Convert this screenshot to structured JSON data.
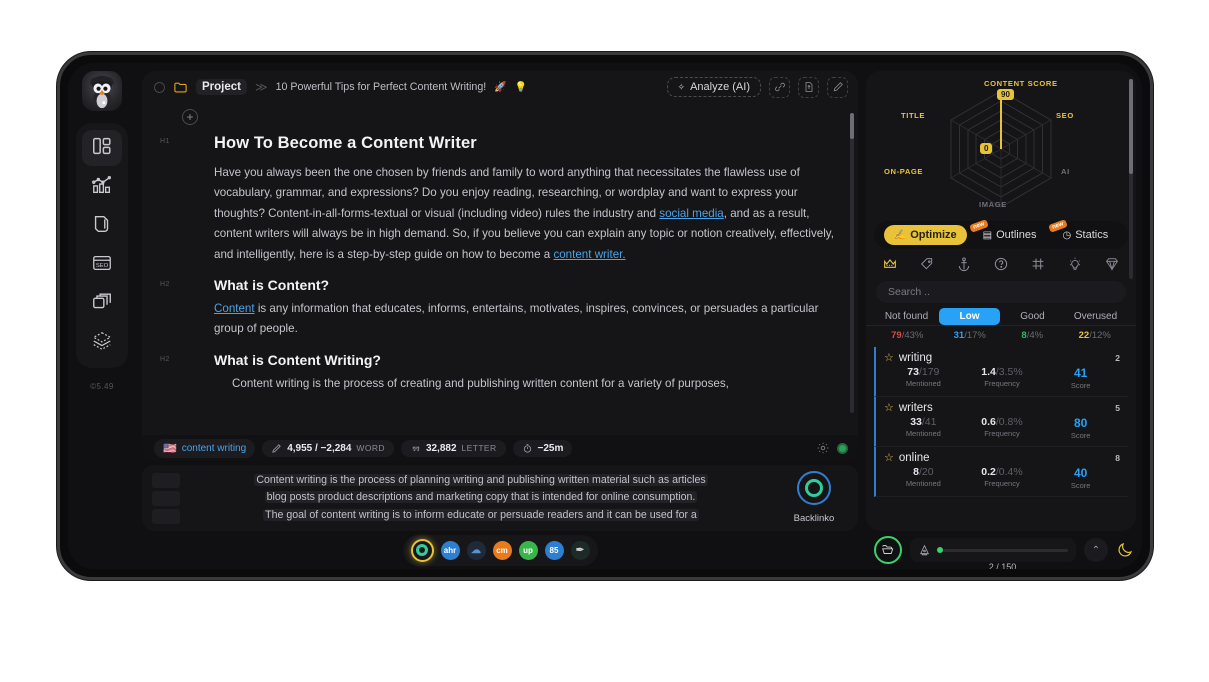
{
  "app": {
    "version": "©5.49"
  },
  "sidebar": {
    "avatar_icon": "penguin-avatar",
    "items": [
      {
        "icon": "dashboard-grid-icon",
        "name": "dashboard"
      },
      {
        "icon": "analytics-chart-icon",
        "name": "analytics"
      },
      {
        "icon": "document-pen-icon",
        "name": "documents"
      },
      {
        "icon": "seo-browser-icon",
        "name": "seo"
      },
      {
        "icon": "stacked-cards-icon",
        "name": "templates"
      },
      {
        "icon": "layers-3d-icon",
        "name": "layers"
      }
    ]
  },
  "breadcrumb": {
    "dot": "",
    "folder_icon": "folder-icon",
    "project": "Project",
    "separator": "≫",
    "doc_title": "10 Powerful Tips for Perfect Content Writing!",
    "emoji_rocket": "🚀",
    "emoji_bulb": "💡"
  },
  "header": {
    "analyze_label": "Analyze (AI)",
    "analyze_spark": "✧",
    "icons": [
      "link-chain-icon",
      "file-export-icon",
      "pen-edit-icon"
    ]
  },
  "document": {
    "add_block": "+",
    "blocks": [
      {
        "tag": "H1",
        "type": "h1",
        "text": "How To Become a Content Writer"
      },
      {
        "tag": "",
        "type": "p",
        "text": "Have you always been the one chosen by friends and family to word anything that necessitates the flawless use of vocabulary, grammar, and expressions? Do you enjoy reading, researching, or wordplay and want to express your thoughts? Content-in-all-forms-textual or visual (including video) rules the industry and "
      },
      {
        "tag": "H2",
        "type": "h2",
        "text": "What is Content?"
      },
      {
        "tag": "H2",
        "type": "h2",
        "text": "What is Content Writing?"
      }
    ],
    "p1_link1": "social media",
    "p1_mid": ", and as a result, content writers will always be in high demand. So, if you believe you can explain any topic or notion creatively, effectively, and intelligently, here is a step-by-step guide on how to become a ",
    "p1_link2": "content writer.",
    "p2_link": "Content",
    "p2_rest": " is any information that educates, informs, entertains, motivates, inspires, convinces, or persuades a particular group of people.",
    "p3": "Content writing is the process of creating and publishing written content for a variety of purposes,"
  },
  "statusbar": {
    "flag": "🇺🇸",
    "keyword": "content writing",
    "word_icon": "pencil-icon",
    "word_value": "4,955 / −2,284",
    "word_unit": "WORD",
    "letter_icon": "quote-icon",
    "letter_value": "32,882",
    "letter_unit": "LETTER",
    "time_icon": "timer-icon",
    "time_value": "−25m",
    "gear_icon": "gear-icon",
    "status_dot": "online-status-dot"
  },
  "preview": {
    "lines": [
      "Content writing is the process of planning writing and publishing written material such as articles",
      "blog posts product descriptions and marketing copy that is intended for online consumption.",
      "The goal of content writing is to inform educate or persuade readers and it can be used for a"
    ],
    "brand": "Backlinko"
  },
  "dock": {
    "items": [
      {
        "name": "backlinko-source",
        "color": "#111316",
        "label": "",
        "selected": true
      },
      {
        "name": "source-blue",
        "color": "#2f7fd0",
        "label": "ahr"
      },
      {
        "name": "source-cloud",
        "color": "#1f2a38",
        "label": "☁"
      },
      {
        "name": "source-orange",
        "color": "#e87b1e",
        "label": "cm"
      },
      {
        "name": "source-green",
        "color": "#3ab54a",
        "label": "up"
      },
      {
        "name": "source-lightblue",
        "color": "#2f7fd0",
        "label": "85"
      },
      {
        "name": "source-dark",
        "color": "#1c2b26",
        "label": "✒"
      }
    ]
  },
  "right_panel": {
    "radar": {
      "center_value": "0",
      "top_value": "90",
      "labels": [
        "CONTENT SCORE",
        "TITLE",
        "SEO",
        "AI",
        "IMAGE",
        "ON-PAGE"
      ]
    },
    "tabs": [
      {
        "label": "Optimize",
        "icon": "optimize-icon",
        "active": true,
        "badge": ""
      },
      {
        "label": "Outlines",
        "icon": "outlines-icon",
        "active": false,
        "badge": "new"
      },
      {
        "label": "Statics",
        "icon": "statics-icon",
        "active": false,
        "badge": "new"
      }
    ],
    "toolbar_icons": [
      {
        "name": "crown-icon",
        "active": true
      },
      {
        "name": "tag-icon",
        "active": false
      },
      {
        "name": "anchor-icon",
        "active": false
      },
      {
        "name": "question-circle-icon",
        "active": false
      },
      {
        "name": "grid-table-icon",
        "active": false
      },
      {
        "name": "lightbulb-icon",
        "active": false
      },
      {
        "name": "diamond-icon",
        "active": false
      }
    ],
    "search_placeholder": "Search ..",
    "filter_tabs": [
      {
        "label": "Not found",
        "active": false
      },
      {
        "label": "Low",
        "active": true
      },
      {
        "label": "Good",
        "active": false
      },
      {
        "label": "Overused",
        "active": false
      }
    ],
    "filter_stats": [
      {
        "count": "79",
        "pct": "/43%",
        "cls": "nf"
      },
      {
        "count": "31",
        "pct": "/17%",
        "cls": "lo"
      },
      {
        "count": "8",
        "pct": "/4%",
        "cls": "gd"
      },
      {
        "count": "22",
        "pct": "/12%",
        "cls": "ov"
      }
    ],
    "keywords": [
      {
        "name": "writing",
        "rank": "2",
        "mentioned": "73",
        "mentioned_den": "/179",
        "frequency": "1.4",
        "frequency_den": "/3.5%",
        "score": "41",
        "l_mentioned": "Mentioned",
        "l_frequency": "Frequency",
        "l_score": "Score"
      },
      {
        "name": "writers",
        "rank": "5",
        "mentioned": "33",
        "mentioned_den": "/41",
        "frequency": "0.6",
        "frequency_den": "/0.8%",
        "score": "80",
        "l_mentioned": "Mentioned",
        "l_frequency": "Frequency",
        "l_score": "Score"
      },
      {
        "name": "online",
        "rank": "8",
        "mentioned": "8",
        "mentioned_den": "/20",
        "frequency": "0.2",
        "frequency_den": "/0.4%",
        "score": "40",
        "l_mentioned": "Mentioned",
        "l_frequency": "Frequency",
        "l_score": "Score"
      }
    ],
    "bottom": {
      "folder_icon": "open-folder-icon",
      "progress_icon": "funnel-icon",
      "progress_text": "2 / 150",
      "chevron": "⌃",
      "moon_icon": "moon-icon"
    }
  },
  "chart_data": {
    "type": "radar",
    "title": "CONTENT SCORE",
    "categories": [
      "CONTENT SCORE",
      "SEO",
      "AI",
      "IMAGE",
      "ON-PAGE",
      "TITLE"
    ],
    "values": [
      90,
      0,
      0,
      0,
      0,
      0
    ],
    "center_label": "0",
    "ylim": [
      0,
      100
    ],
    "grid": true,
    "legend": "none",
    "accent_color": "#e8c33a"
  }
}
